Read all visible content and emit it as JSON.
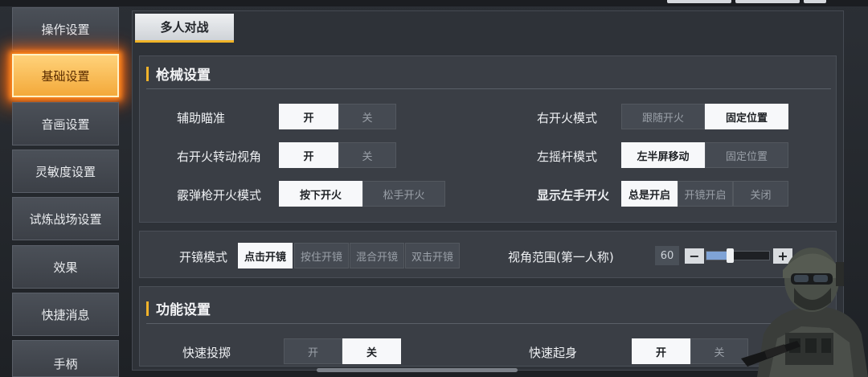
{
  "sidebar": {
    "items": [
      {
        "label": "操作设置"
      },
      {
        "label": "基础设置"
      },
      {
        "label": "音画设置"
      },
      {
        "label": "灵敏度设置"
      },
      {
        "label": "试炼战场设置"
      },
      {
        "label": "效果"
      },
      {
        "label": "快捷消息"
      },
      {
        "label": "手柄"
      }
    ],
    "active_index": 1
  },
  "tabs": [
    {
      "label": "多人对战"
    }
  ],
  "gun_section": {
    "title": "枪械设置",
    "aim_assist": {
      "label": "辅助瞄准",
      "options": [
        "开",
        "关"
      ],
      "selected": "开"
    },
    "right_fire_mode": {
      "label": "右开火模式",
      "options": [
        "跟随开火",
        "固定位置"
      ],
      "selected": "固定位置"
    },
    "right_fire_turn": {
      "label": "右开火转动视角",
      "options": [
        "开",
        "关"
      ],
      "selected": "开"
    },
    "left_stick_mode": {
      "label": "左摇杆模式",
      "options": [
        "左半屏移动",
        "固定位置"
      ],
      "selected": "左半屏移动"
    },
    "shotgun_fire_mode": {
      "label": "霰弹枪开火模式",
      "options": [
        "按下开火",
        "松手开火"
      ],
      "selected": "按下开火"
    },
    "show_left_fire": {
      "label": "显示左手开火",
      "options": [
        "总是开启",
        "开镜开启",
        "关闭"
      ],
      "selected": "总是开启"
    }
  },
  "scope_section": {
    "scope_mode": {
      "label": "开镜模式",
      "options": [
        "点击开镜",
        "按住开镜",
        "混合开镜",
        "双击开镜"
      ],
      "selected": "点击开镜"
    },
    "fov": {
      "label": "视角范围(第一人称)",
      "value": "60",
      "minus": "−",
      "plus": "+",
      "level": 0.38
    }
  },
  "function_section": {
    "title": "功能设置",
    "quick_throw": {
      "label": "快速投掷",
      "options": [
        "开",
        "关"
      ],
      "selected": "关"
    },
    "quick_rise": {
      "label": "快速起身",
      "options": [
        "开",
        "关"
      ],
      "selected": "开"
    }
  },
  "colors": {
    "accent": "#f2b32a",
    "active_glow": "#ff8a1e",
    "selected_bg": "#f7f8fa"
  }
}
